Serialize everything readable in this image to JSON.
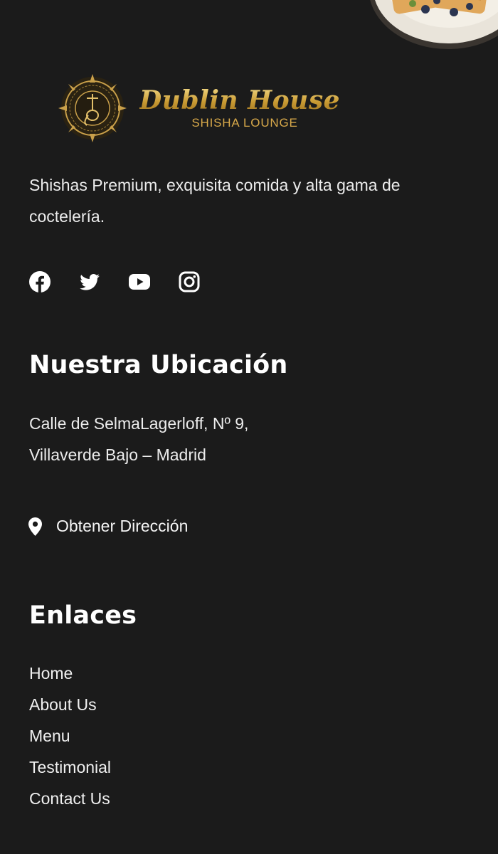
{
  "brand": {
    "name": "Dublin House",
    "subtitle": "SHISHA LOUNGE"
  },
  "tagline": "Shishas Premium, exquisita comida y alta gama de coctelería.",
  "social": [
    {
      "icon": "facebook-icon"
    },
    {
      "icon": "twitter-icon"
    },
    {
      "icon": "youtube-icon"
    },
    {
      "icon": "instagram-icon"
    }
  ],
  "location": {
    "heading": "Nuestra Ubicación",
    "address_line1": "Calle de SelmaLagerloff, Nº 9,",
    "address_line2": "Villaverde Bajo – Madrid",
    "directions_label": "Obtener Dirección"
  },
  "links": {
    "heading": "Enlaces",
    "items": [
      "Home",
      "About Us",
      "Menu",
      "Testimonial",
      "Contact Us"
    ]
  },
  "colors": {
    "background": "#1b1b1b",
    "gold": "#d8a94a",
    "text": "#ececec"
  }
}
